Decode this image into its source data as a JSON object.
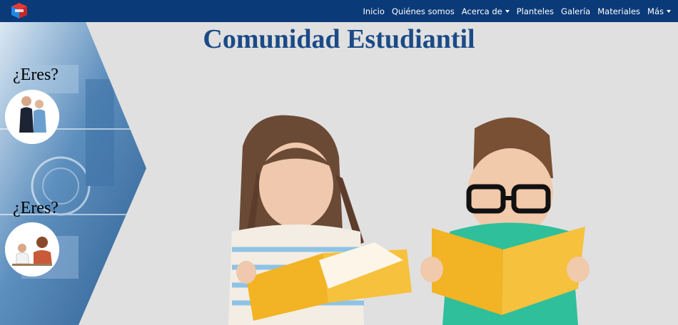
{
  "nav": {
    "items": [
      {
        "label": "Inicio",
        "dropdown": false
      },
      {
        "label": "Quiénes somos",
        "dropdown": false
      },
      {
        "label": "Acerca de",
        "dropdown": true
      },
      {
        "label": "Planteles",
        "dropdown": false
      },
      {
        "label": "Galería",
        "dropdown": false
      },
      {
        "label": "Materiales",
        "dropdown": false
      },
      {
        "label": "Más",
        "dropdown": true
      }
    ]
  },
  "page": {
    "title": "Comunidad Estudiantil"
  },
  "side": {
    "question_1": "¿Eres?",
    "question_2": "¿Eres?"
  },
  "colors": {
    "navbar": "#0b3a78",
    "title": "#1b4a86",
    "background": "#e0e0e0"
  }
}
